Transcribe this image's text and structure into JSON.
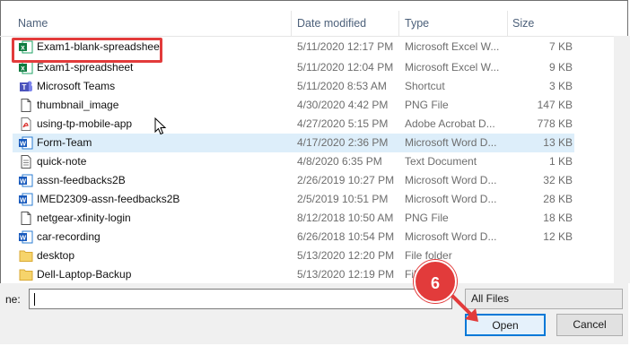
{
  "header": {
    "name": "Name",
    "date_modified": "Date modified",
    "type": "Type",
    "size": "Size"
  },
  "files": [
    {
      "name": "Exam1-blank-spreadsheet",
      "date": "5/11/2020 12:17 PM",
      "type": "Microsoft Excel W...",
      "size": "7 KB",
      "icon": "excel-icon"
    },
    {
      "name": "Exam1-spreadsheet",
      "date": "5/11/2020 12:04 PM",
      "type": "Microsoft Excel W...",
      "size": "9 KB",
      "icon": "excel-icon"
    },
    {
      "name": "Microsoft Teams",
      "date": "5/11/2020 8:53 AM",
      "type": "Shortcut",
      "size": "3 KB",
      "icon": "teams-icon"
    },
    {
      "name": "thumbnail_image",
      "date": "4/30/2020 4:42 PM",
      "type": "PNG File",
      "size": "147 KB",
      "icon": "image-file-icon"
    },
    {
      "name": "using-tp-mobile-app",
      "date": "4/27/2020 5:15 PM",
      "type": "Adobe Acrobat D...",
      "size": "778 KB",
      "icon": "pdf-icon"
    },
    {
      "name": "Form-Team",
      "date": "4/17/2020 2:36 PM",
      "type": "Microsoft Word D...",
      "size": "13 KB",
      "icon": "word-icon"
    },
    {
      "name": "quick-note",
      "date": "4/8/2020 6:35 PM",
      "type": "Text Document",
      "size": "1 KB",
      "icon": "text-file-icon"
    },
    {
      "name": "assn-feedbacks2B",
      "date": "2/26/2019 10:27 PM",
      "type": "Microsoft Word D...",
      "size": "32 KB",
      "icon": "word-icon"
    },
    {
      "name": "IMED2309-assn-feedbacks2B",
      "date": "2/5/2019 10:51 PM",
      "type": "Microsoft Word D...",
      "size": "28 KB",
      "icon": "word-icon"
    },
    {
      "name": "netgear-xfinity-login",
      "date": "8/12/2018 10:50 AM",
      "type": "PNG File",
      "size": "18 KB",
      "icon": "image-file-icon"
    },
    {
      "name": "car-recording",
      "date": "6/26/2018 10:54 PM",
      "type": "Microsoft Word D...",
      "size": "12 KB",
      "icon": "word-icon"
    },
    {
      "name": "desktop",
      "date": "5/13/2020 12:20 PM",
      "type": "File folder",
      "size": "",
      "icon": "folder-icon"
    },
    {
      "name": "Dell-Laptop-Backup",
      "date": "5/13/2020 12:19 PM",
      "type": "File folder",
      "size": "",
      "icon": "folder-icon"
    }
  ],
  "bottom": {
    "file_name_label": "ne:",
    "file_name_value": "",
    "filter_value": "All Files",
    "open_label": "Open",
    "cancel_label": "Cancel"
  },
  "annotation": {
    "step_number": "6",
    "color": "#e23b3b"
  },
  "colors": {
    "selected_row": "#ddeefa",
    "accent": "#0078d7"
  }
}
